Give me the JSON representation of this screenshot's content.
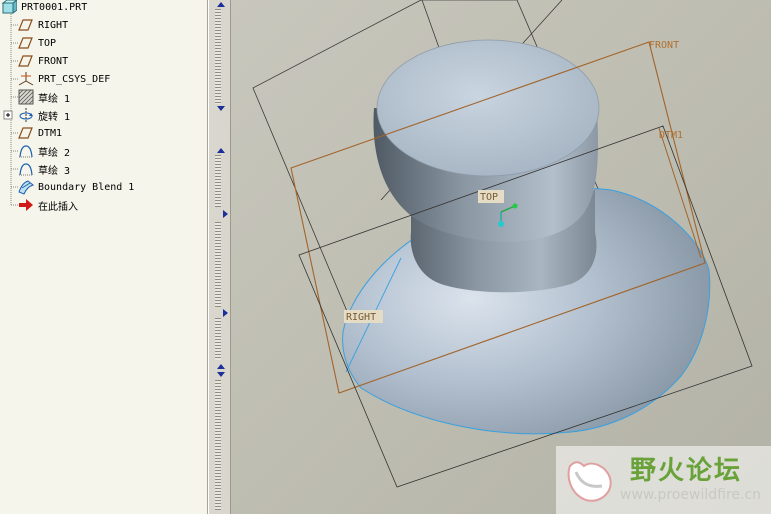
{
  "model_tree": {
    "root": {
      "label": "PRT0001.PRT",
      "icon": "part-icon"
    },
    "items": [
      {
        "label": "RIGHT",
        "icon": "datum-plane-icon"
      },
      {
        "label": "TOP",
        "icon": "datum-plane-icon"
      },
      {
        "label": "FRONT",
        "icon": "datum-plane-icon"
      },
      {
        "label": "PRT_CSYS_DEF",
        "icon": "coordinate-system-icon"
      },
      {
        "label": "草绘 1",
        "icon": "sketch-hatched-icon"
      },
      {
        "label": "旋转 1",
        "icon": "revolve-icon",
        "expandable": true
      },
      {
        "label": "DTM1",
        "icon": "datum-plane-icon"
      },
      {
        "label": "草绘 2",
        "icon": "sketch-curve-icon"
      },
      {
        "label": "草绘 3",
        "icon": "sketch-curve-icon"
      },
      {
        "label": "Boundary Blend 1",
        "icon": "boundary-blend-icon"
      },
      {
        "label": "在此插入",
        "icon": "insert-here-arrow-icon"
      }
    ]
  },
  "viewport": {
    "datum_tags": {
      "front": "FRONT",
      "dtm1": "DTM1",
      "top": "TOP",
      "right": "RIGHT"
    },
    "colors": {
      "front_plane": "#a2642a",
      "datum_tag": "#b07030",
      "edge_highlight": "#3aa0e0",
      "solid": "#a8b6c4"
    }
  },
  "watermark": {
    "title": "野火论坛",
    "url": "www.proewildfire.cn"
  }
}
